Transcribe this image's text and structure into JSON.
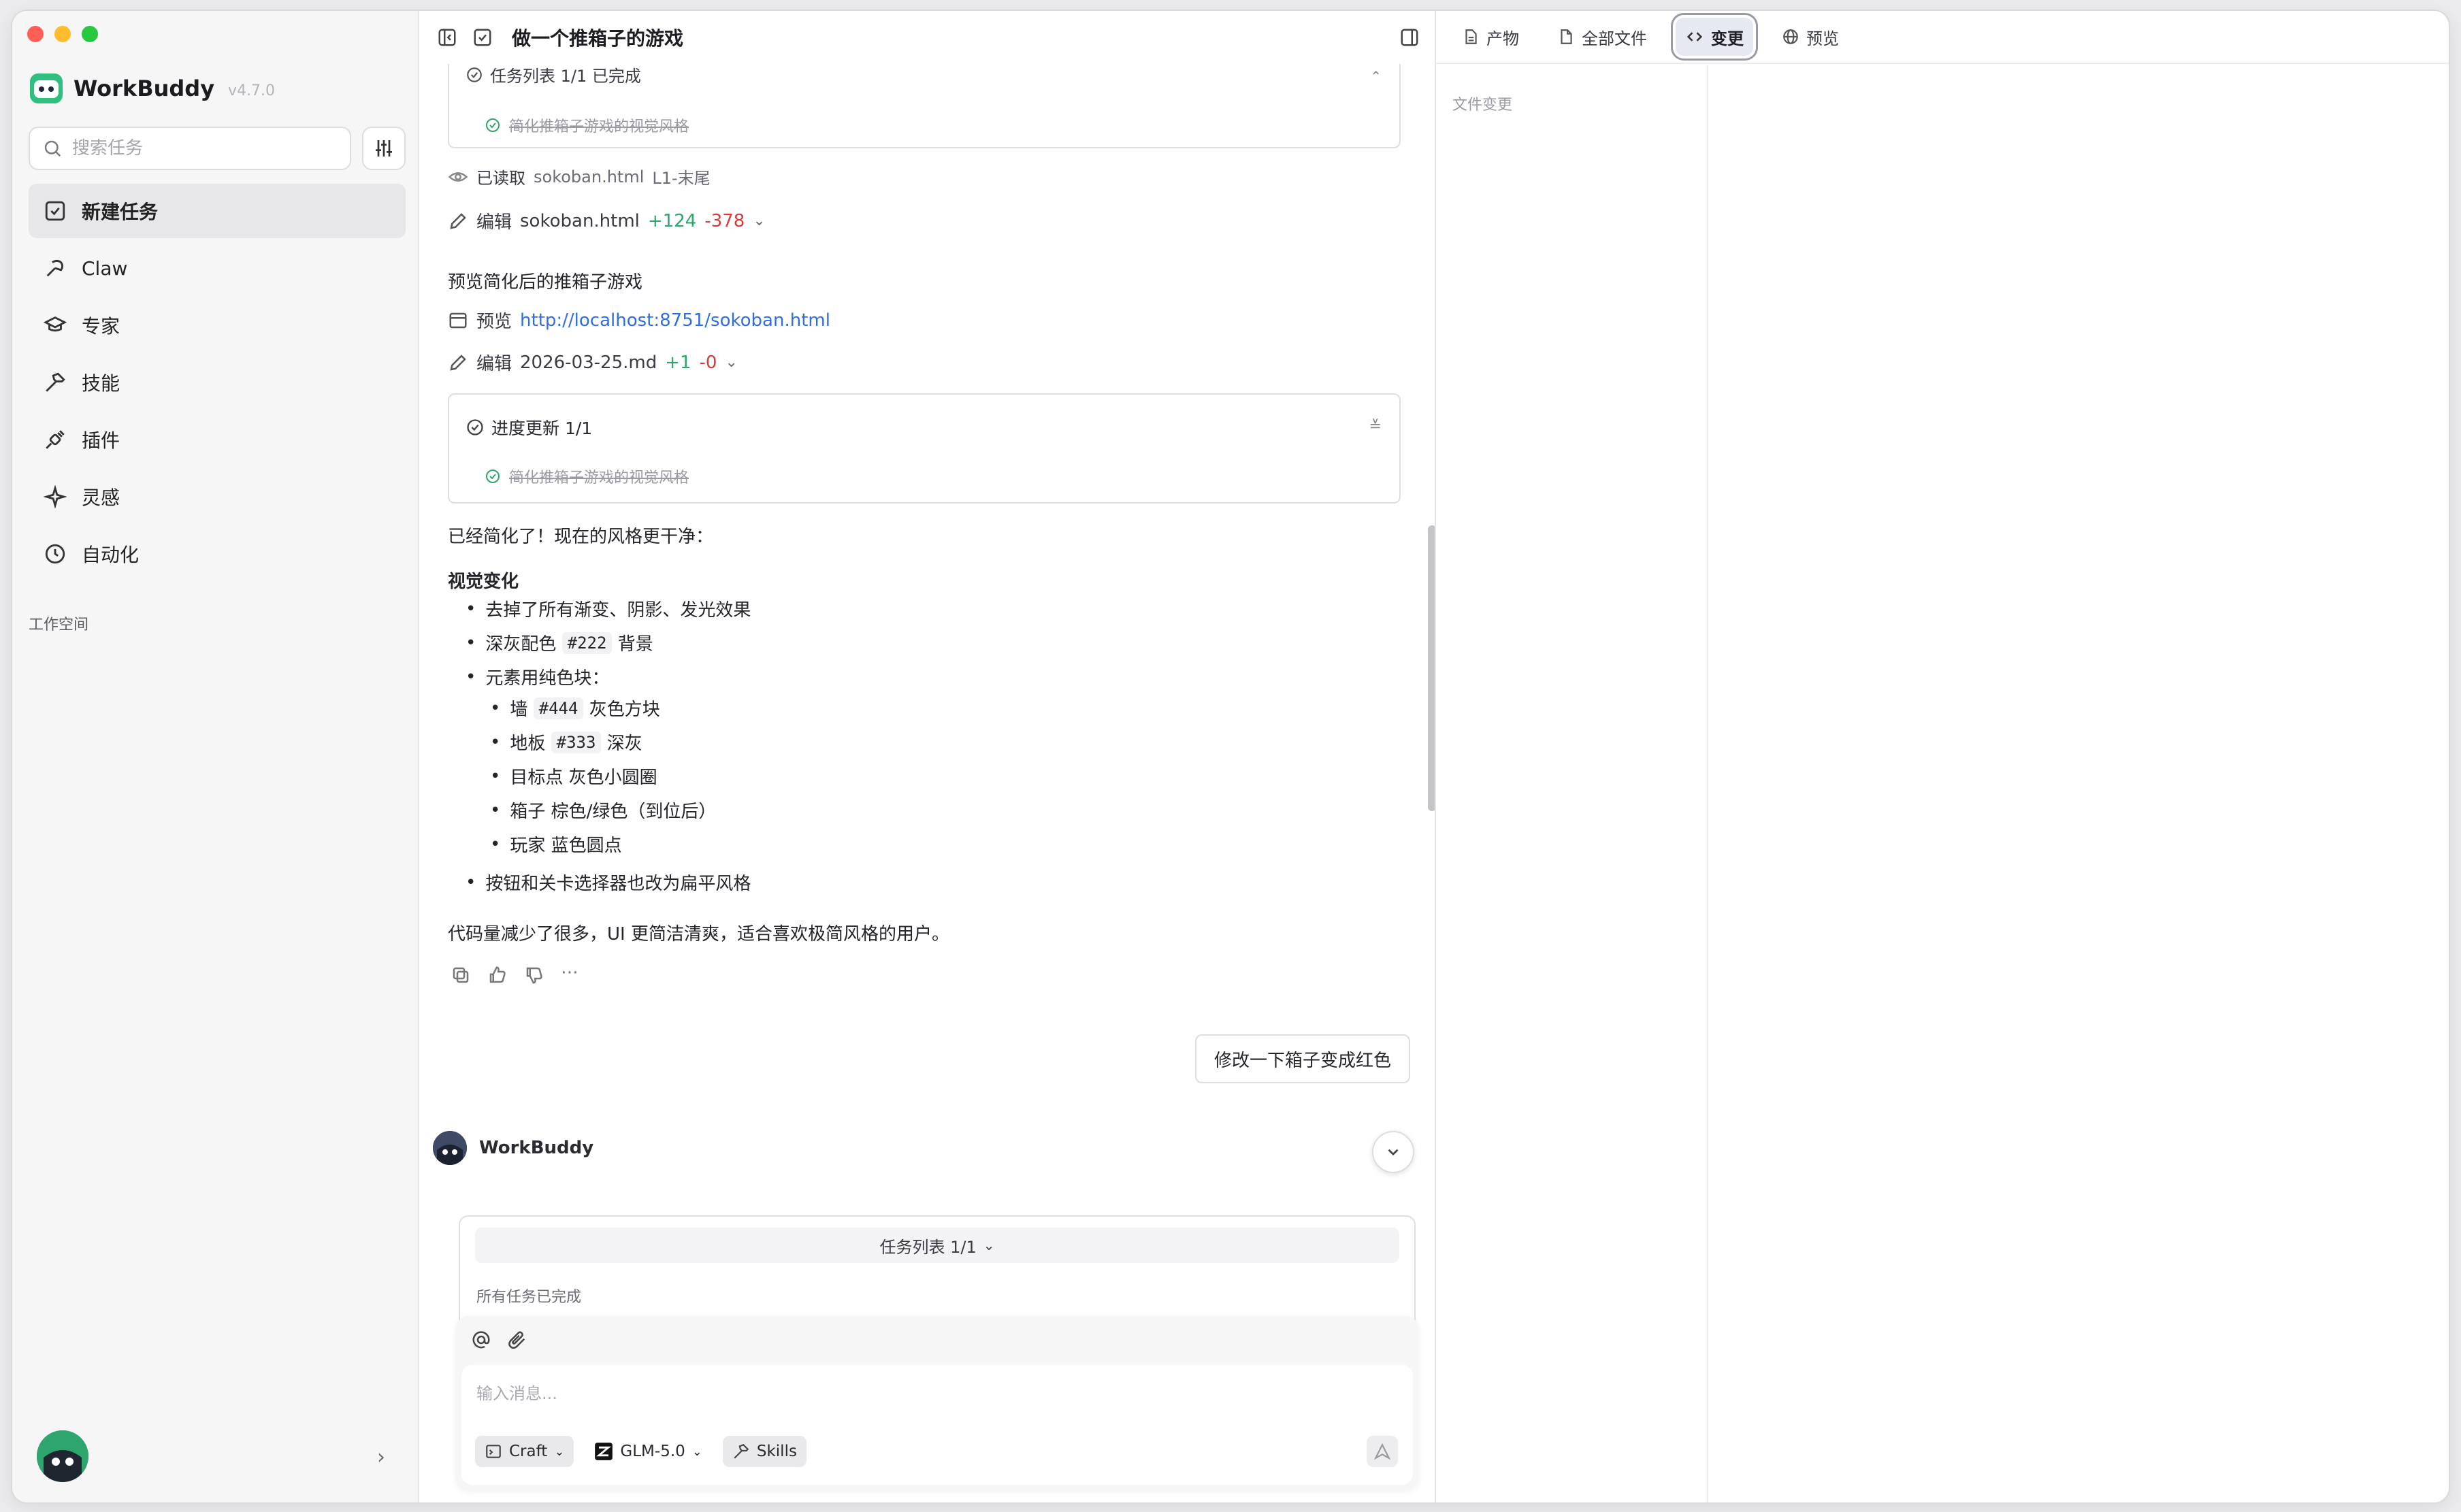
{
  "app": {
    "name": "WorkBuddy",
    "version": "v4.7.0"
  },
  "sidebar": {
    "search_placeholder": "搜索任务",
    "items": [
      {
        "label": "新建任务",
        "icon": "edit-square-icon",
        "active": true
      },
      {
        "label": "Claw",
        "icon": "claw-icon"
      },
      {
        "label": "专家",
        "icon": "graduation-cap-icon"
      },
      {
        "label": "技能",
        "icon": "hammer-icon"
      },
      {
        "label": "插件",
        "icon": "plug-icon"
      },
      {
        "label": "灵感",
        "icon": "sparkle-icon"
      },
      {
        "label": "自动化",
        "icon": "clock-icon"
      }
    ],
    "workspace_label": "工作空间"
  },
  "chat": {
    "title": "做一个推箱子的游戏",
    "card1": {
      "header": "任务列表 1/1 已完成",
      "item": "简化推箱子游戏的视觉风格"
    },
    "read": {
      "label": "已读取",
      "file": "sokoban.html",
      "range": "L1-末尾"
    },
    "edit1": {
      "label": "编辑",
      "file": "sokoban.html",
      "add": "+124",
      "del": "-378"
    },
    "preview_heading": "预览简化后的推箱子游戏",
    "preview": {
      "label": "预览",
      "url": "http://localhost:8751/sokoban.html"
    },
    "edit2": {
      "label": "编辑",
      "file": "2026-03-25.md",
      "add": "+1",
      "del": "-0"
    },
    "card2": {
      "header": "进度更新 1/1",
      "item": "简化推箱子游戏的视觉风格"
    },
    "intro": "已经简化了！现在的风格更干净：",
    "section_title": "视觉变化",
    "bullets": {
      "b1": "去掉了所有渐变、阴影、发光效果",
      "b2_pre": "深灰配色",
      "b2_code": "#222",
      "b2_post": "背景",
      "b3": "元素用纯色块：",
      "s1_pre": "墙",
      "s1_code": "#444",
      "s1_post": "灰色方块",
      "s2_pre": "地板",
      "s2_code": "#333",
      "s2_post": "深灰",
      "s3": "目标点 灰色小圆圈",
      "s4": "箱子 棕色/绿色（到位后）",
      "s5": "玩家 蓝色圆点",
      "b4": "按钮和关卡选择器也改为扁平风格"
    },
    "outro": "代码量减少了很多，UI 更简洁清爽，适合喜欢极简风格的用户。",
    "user_message": "修改一下箱子变成红色",
    "bot_name": "WorkBuddy",
    "taskbar": {
      "label": "任务列表 1/1",
      "done": "所有任务已完成"
    },
    "composer": {
      "placeholder": "输入消息...",
      "mode": "Craft",
      "model": "GLM-5.0",
      "skills": "Skills"
    }
  },
  "right_panel": {
    "tabs": [
      {
        "label": "产物",
        "icon": "document-icon"
      },
      {
        "label": "全部文件",
        "icon": "file-icon"
      },
      {
        "label": "变更",
        "icon": "code-icon",
        "active": true
      },
      {
        "label": "预览",
        "icon": "globe-icon"
      }
    ],
    "files_label": "文件变更"
  },
  "colors": {
    "accent_green": "#2ea56a",
    "accent_red": "#d73a3a",
    "link": "#2f6ee0",
    "brand": "#2fa56e"
  }
}
